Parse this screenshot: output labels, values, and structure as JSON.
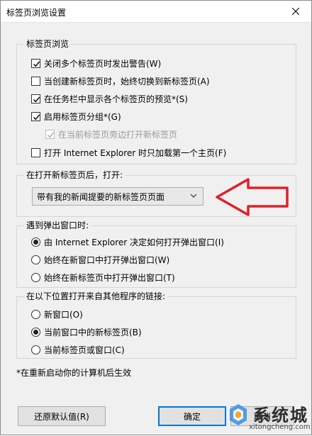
{
  "window": {
    "title": "标签页浏览设置"
  },
  "tab_browsing": {
    "title": "标签页浏览",
    "options": [
      {
        "label": "关闭多个标签页时发出警告(W)",
        "checked": true,
        "enabled": true
      },
      {
        "label": "当创建新标签页时，始终切换到新标签页(A)",
        "checked": false,
        "enabled": true
      },
      {
        "label": "在任务栏中显示各个标签页的预览*(S)",
        "checked": true,
        "enabled": true
      },
      {
        "label": "启用标签页分组*(G)",
        "checked": true,
        "enabled": true
      },
      {
        "label": "在当前标签页旁边打开新标签页",
        "checked": true,
        "enabled": false
      },
      {
        "label": "打开 Internet Explorer 时只加载第一个主页(F)",
        "checked": false,
        "enabled": true
      }
    ]
  },
  "new_tab": {
    "title": "在打开新标签页后，打开:",
    "selected": "带有我的新闻提要的新标签页页面"
  },
  "popups": {
    "title": "遇到弹出窗口时:",
    "options": [
      {
        "label": "由 Internet Explorer 决定如何打开弹出窗口(I)",
        "selected": true
      },
      {
        "label": "始终在新窗口中打开弹出窗口(W)",
        "selected": false
      },
      {
        "label": "始终在新标签页中打开弹出窗口(T)",
        "selected": false
      }
    ]
  },
  "links": {
    "title": "在以下位置打开来自其他程序的链接:",
    "options": [
      {
        "label": "新窗口(O)",
        "selected": false
      },
      {
        "label": "当前窗口中的新标签页(B)",
        "selected": true
      },
      {
        "label": "当前标签页或窗口(C)",
        "selected": false
      }
    ]
  },
  "footnote": "*在重新启动你的计算机后生效",
  "buttons": {
    "restore": "还原默认值(R)",
    "ok": "确定",
    "cancel": "取消"
  },
  "watermark": {
    "text": "系统城",
    "url": "xitongcheng.com"
  },
  "colors": {
    "annotation_arrow": "#e0202a",
    "focus_border": "#0078d7"
  }
}
